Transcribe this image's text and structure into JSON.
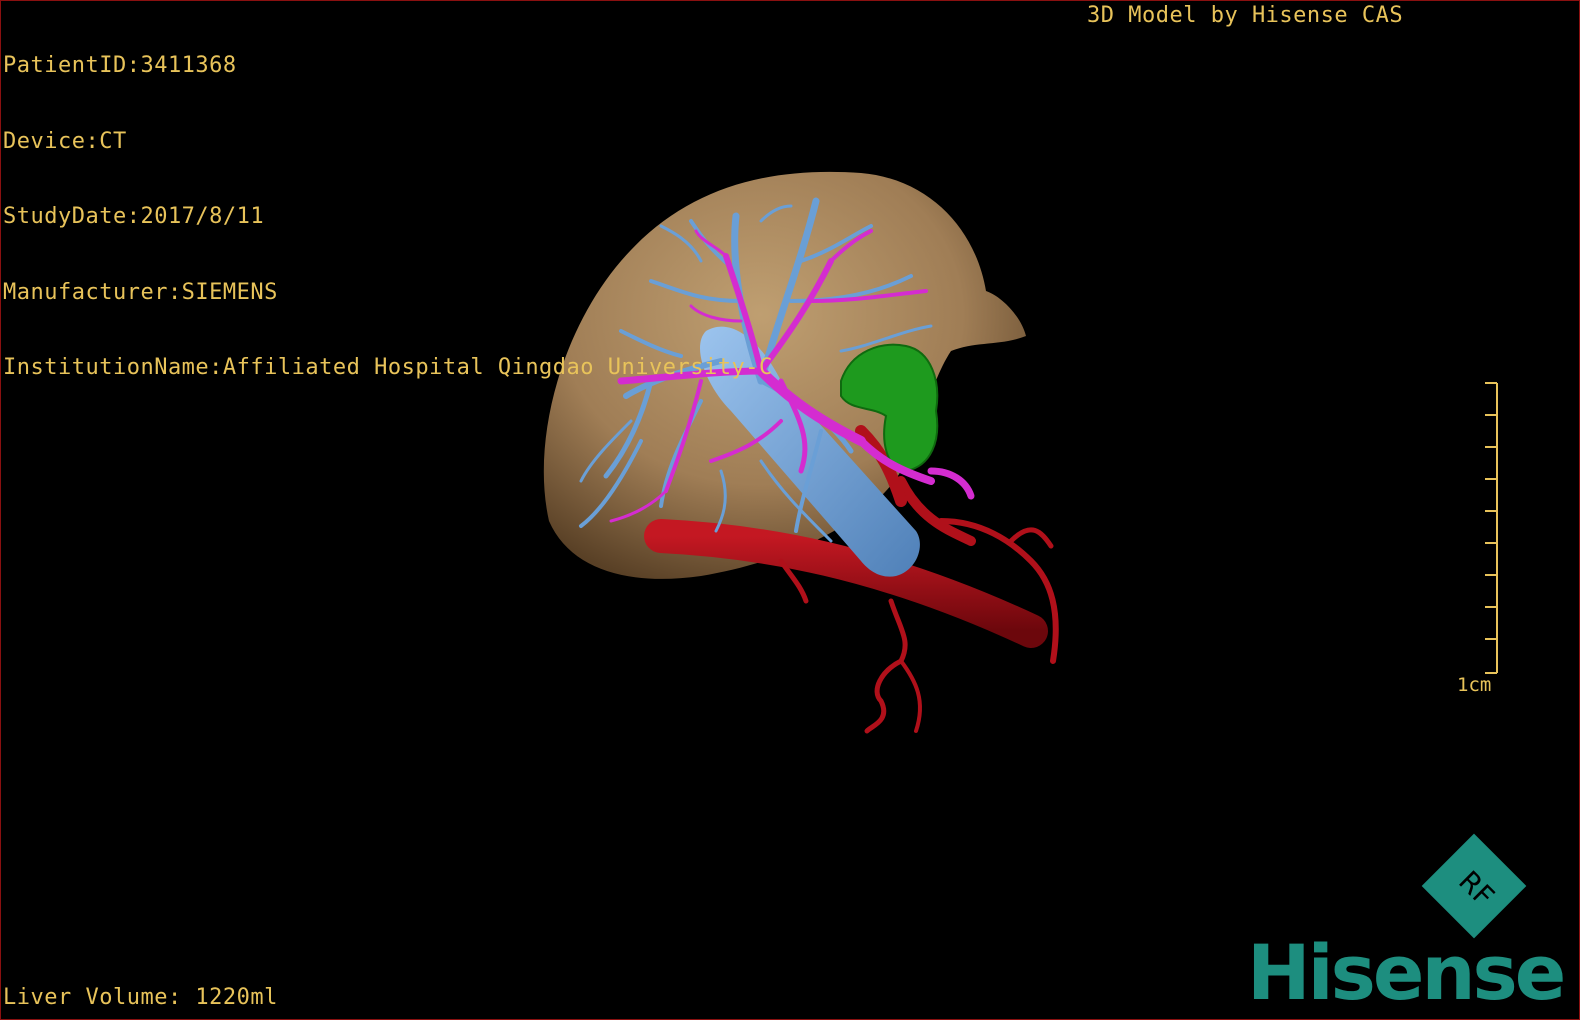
{
  "header": {
    "patient_id": "PatientID:3411368",
    "device": "Device:CT",
    "study_date": "StudyDate:2017/8/11",
    "manufacturer": "Manufacturer:SIEMENS",
    "institution": "InstitutionName:Affiliated Hospital Qingdao University-C"
  },
  "title": "3D Model by Hisense CAS",
  "footer": {
    "liver_volume": "Liver Volume: 1220ml"
  },
  "scale_bar": {
    "label": "1cm"
  },
  "logo": {
    "brand": "Hisense",
    "badge": "RF"
  },
  "colors": {
    "background": "#000000",
    "text": "#e8c35a",
    "liver": "#a8845a",
    "hepatic_veins": "#6a9fd6",
    "portal_vein": "#d42cd0",
    "arteries": "#b0101a",
    "gallbladder": "#1e9a1e",
    "brand": "#1d8e7f",
    "border": "#8a1010"
  }
}
